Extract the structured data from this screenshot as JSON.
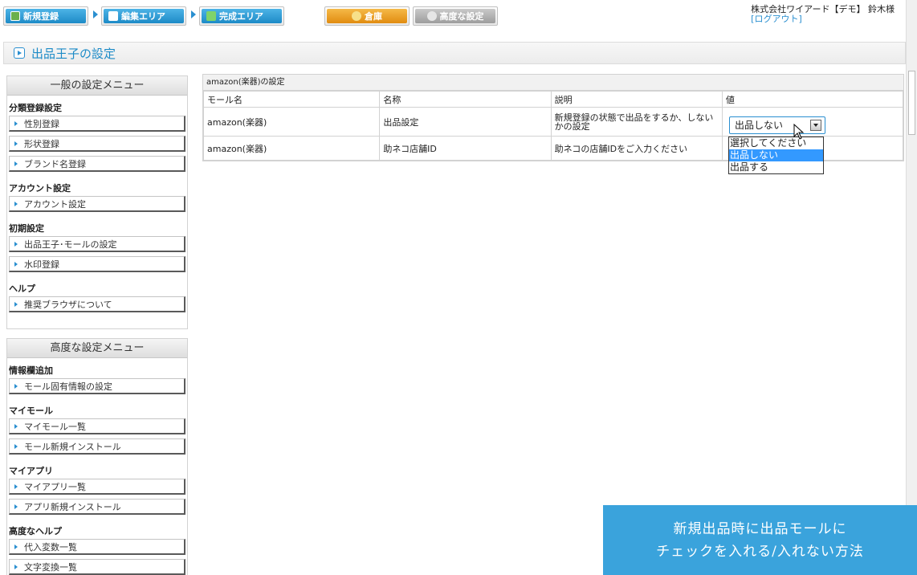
{
  "nav": {
    "tabs": [
      {
        "label": "新規登録",
        "icon": "pencil-icon"
      },
      {
        "label": "編集エリア",
        "icon": "edit-icon"
      },
      {
        "label": "完成エリア",
        "icon": "done-icon"
      },
      {
        "label": "倉庫",
        "icon": "box-icon"
      },
      {
        "label": "高度な設定",
        "icon": "gear-icon"
      }
    ],
    "user": "株式会社ワイアード【デモ】 鈴木様",
    "logout": "[ログアウト]"
  },
  "page": {
    "title": "出品王子の設定"
  },
  "general_menu": {
    "title": "一般の設定メニュー",
    "sections": [
      {
        "title": "分類登録設定",
        "items": [
          "性別登録",
          "形状登録",
          "ブランド名登録"
        ]
      },
      {
        "title": "アカウント設定",
        "items": [
          "アカウント設定"
        ]
      },
      {
        "title": "初期設定",
        "items": [
          "出品王子･モールの設定",
          "水印登録"
        ]
      },
      {
        "title": "ヘルプ",
        "items": [
          "推奨ブラウザについて"
        ]
      }
    ]
  },
  "advanced_menu": {
    "title": "高度な設定メニュー",
    "sections": [
      {
        "title": "情報欄追加",
        "items": [
          "モール固有情報の設定"
        ]
      },
      {
        "title": "マイモール",
        "items": [
          "マイモール一覧",
          "モール新規インストール"
        ]
      },
      {
        "title": "マイアプリ",
        "items": [
          "マイアプリ一覧",
          "アプリ新規インストール"
        ]
      },
      {
        "title": "高度なヘルプ",
        "items": [
          "代入変数一覧",
          "文字変換一覧"
        ]
      }
    ]
  },
  "settings_table": {
    "caption": "amazon(楽器)の設定",
    "headers": [
      "モール名",
      "名称",
      "説明",
      "値"
    ],
    "rows": [
      {
        "mall": "amazon(楽器)",
        "name": "出品設定",
        "desc": "新規登録の状態で出品をするか、しないかの設定"
      },
      {
        "mall": "amazon(楽器)",
        "name": "助ネコ店舗ID",
        "desc": "助ネコの店舗IDをご入力ください"
      }
    ]
  },
  "select": {
    "value": "出品しない",
    "options": [
      "選択してください",
      "出品しない",
      "出品する"
    ],
    "highlighted": "出品しない"
  },
  "banner": {
    "line1": "新規出品時に出品モールに",
    "line2": "チェックを入れる/入れない方法"
  },
  "colors": {
    "accent": "#2a8fd0",
    "banner": "#3aa3dc",
    "tab_blue": "#1d8bc7",
    "tab_orange": "#e18c10"
  }
}
